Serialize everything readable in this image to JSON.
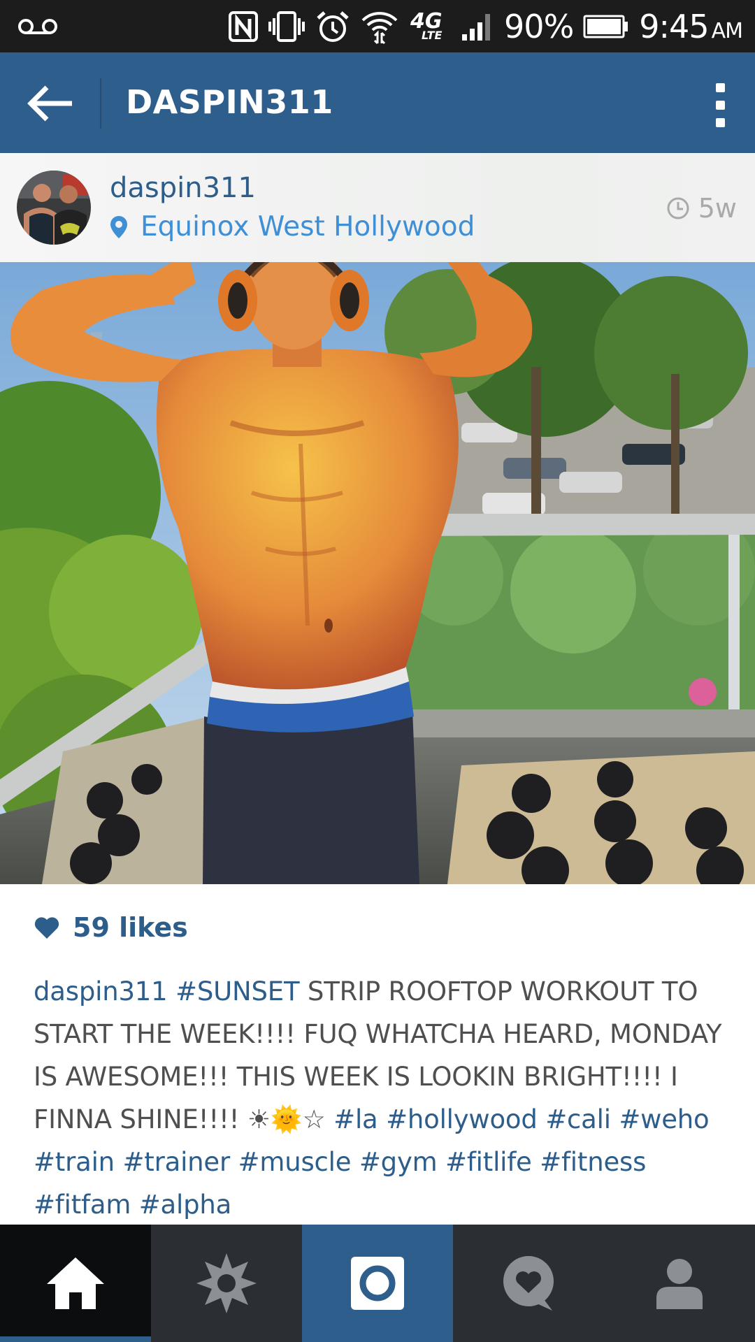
{
  "status_bar": {
    "icons": [
      "voicemail-icon",
      "nfc-icon",
      "vibrate-icon",
      "alarm-icon",
      "wifi-icon",
      "4g-lte-icon",
      "signal-icon",
      "battery-icon"
    ],
    "network_label": "4G",
    "network_sub": "LTE",
    "battery_percent": "90%",
    "time": "9:45",
    "ampm": "AM"
  },
  "app_bar": {
    "title": "DASPIN311",
    "back_icon": "arrow-left-icon",
    "menu_icon": "overflow-menu-icon"
  },
  "post": {
    "username": "daspin311",
    "location": "Equinox West Hollywood",
    "time_ago": "5w",
    "likes": "59 likes",
    "caption": {
      "username": "daspin311",
      "first_tag": "#SUNSET",
      "text": " STRIP ROOFTOP WORKOUT TO START THE WEEK!!!! FUQ WHATCHA HEARD, MONDAY IS AWESOME!!! THIS WEEK IS LOOKIN BRIGHT!!!! I FINNA SHINE!!!! ☀🌞☆ ",
      "hashtags": "#la #hollywood #cali #weho #train #trainer #muscle #gym #fitlife #fitness #fitfam #alpha"
    }
  },
  "bottom_nav": {
    "items": [
      "home",
      "explore",
      "camera",
      "activity",
      "profile"
    ],
    "active": "home"
  },
  "colors": {
    "brand_blue": "#2e5e8c",
    "link_blue": "#3f8fd6",
    "status_bar": "#1c1c1c",
    "nav_bar": "#2b2f33"
  }
}
